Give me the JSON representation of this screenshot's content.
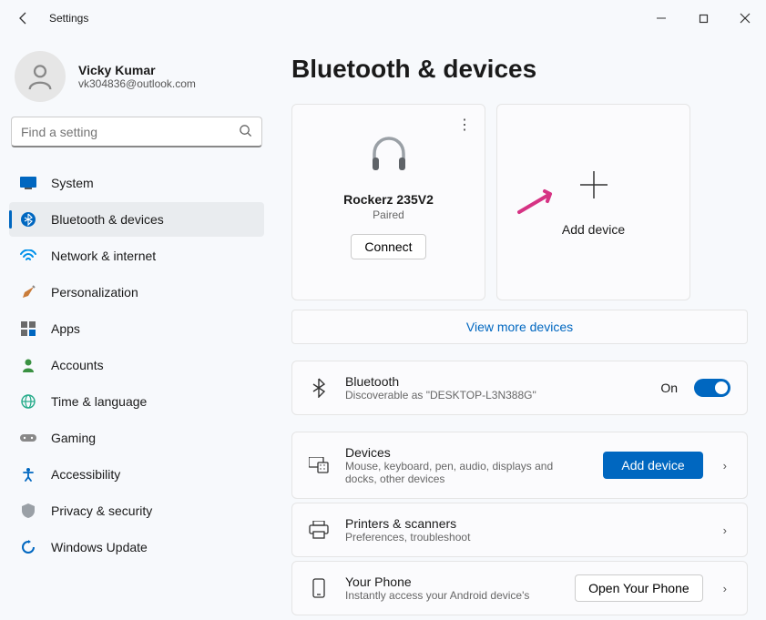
{
  "titlebar": {
    "title": "Settings"
  },
  "user": {
    "name": "Vicky Kumar",
    "email": "vk304836@outlook.com"
  },
  "search": {
    "placeholder": "Find a setting"
  },
  "nav": [
    {
      "label": "System"
    },
    {
      "label": "Bluetooth & devices"
    },
    {
      "label": "Network & internet"
    },
    {
      "label": "Personalization"
    },
    {
      "label": "Apps"
    },
    {
      "label": "Accounts"
    },
    {
      "label": "Time & language"
    },
    {
      "label": "Gaming"
    },
    {
      "label": "Accessibility"
    },
    {
      "label": "Privacy & security"
    },
    {
      "label": "Windows Update"
    }
  ],
  "page": {
    "title": "Bluetooth & devices"
  },
  "device": {
    "name": "Rockerz 235V2",
    "status": "Paired",
    "connect_label": "Connect"
  },
  "add_device": {
    "label": "Add device"
  },
  "view_more": {
    "label": "View more devices"
  },
  "bluetooth_row": {
    "title": "Bluetooth",
    "subtitle": "Discoverable as \"DESKTOP-L3N388G\"",
    "state_label": "On"
  },
  "devices_row": {
    "title": "Devices",
    "subtitle": "Mouse, keyboard, pen, audio, displays and docks, other devices",
    "button_label": "Add device"
  },
  "printers_row": {
    "title": "Printers & scanners",
    "subtitle": "Preferences, troubleshoot"
  },
  "phone_row": {
    "title": "Your Phone",
    "subtitle": "Instantly access your Android device's",
    "button_label": "Open Your Phone"
  }
}
